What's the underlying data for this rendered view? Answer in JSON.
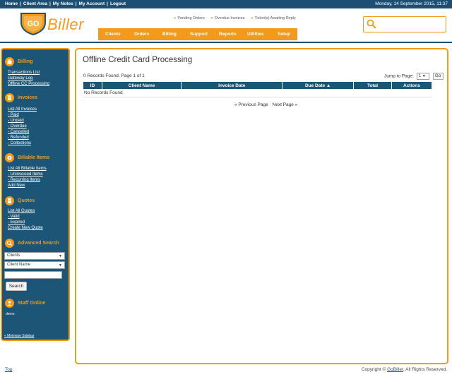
{
  "topbar": {
    "links": [
      "Home",
      "Client Area",
      "My Notes",
      "My Account",
      "Logout"
    ],
    "separator": "|",
    "datetime": "Monday, 14 September 2015, 11:37"
  },
  "logo": {
    "badge": "GO",
    "brand": "Biller"
  },
  "notices": [
    "Pending Orders",
    "Overdue Invoices",
    "Ticket(s) Awaiting Reply"
  ],
  "nav": [
    "Clients",
    "Orders",
    "Billing",
    "Support",
    "Reports",
    "Utilities",
    "Setup"
  ],
  "sidebar": {
    "billing": {
      "title": "Billing",
      "links": [
        "Transactions List",
        "Gateway Log",
        "Offline CC Processing"
      ]
    },
    "invoices": {
      "title": "Invoices",
      "links": [
        "List All Invoices",
        "- Paid",
        "- Unpaid",
        "- Overdue",
        "- Cancelled",
        "- Refunded",
        "- Collections"
      ]
    },
    "billable": {
      "title": "Billable Items",
      "links": [
        "List All Billable Items",
        "- Uninvoiced Items",
        "- Recurring Items",
        "Add New"
      ]
    },
    "quotes": {
      "title": "Quotes",
      "links": [
        "List All Quotes",
        "- Valid",
        "- Expired",
        "Create New Quote"
      ]
    },
    "advanced": {
      "title": "Advanced Search",
      "type_value": "Clients",
      "field_value": "Client Name",
      "search_label": "Search"
    },
    "staff": {
      "title": "Staff Online",
      "users": [
        "demo"
      ]
    },
    "minimise_label": "« Minimise Sidebar"
  },
  "main": {
    "title": "Offline Credit Card Processing",
    "records_text": "0 Records Found, Page 1 of 1",
    "jump_label": "Jump to Page:",
    "jump_value": "1",
    "go_label": "Go",
    "columns": [
      "ID",
      "Client Name",
      "Invoice Date",
      "Due Date ▲",
      "Total",
      "Actions"
    ],
    "empty_text": "No Records Found",
    "prev_label": "« Previous Page",
    "next_label": "Next Page »"
  },
  "footer": {
    "top_label": "Top",
    "copyright_prefix": "Copyright ©",
    "copyright_brand": "GoBiller",
    "copyright_suffix": ". All Rights Reserved."
  },
  "colors": {
    "navy": "#1c5576",
    "orange": "#f39a1a"
  }
}
